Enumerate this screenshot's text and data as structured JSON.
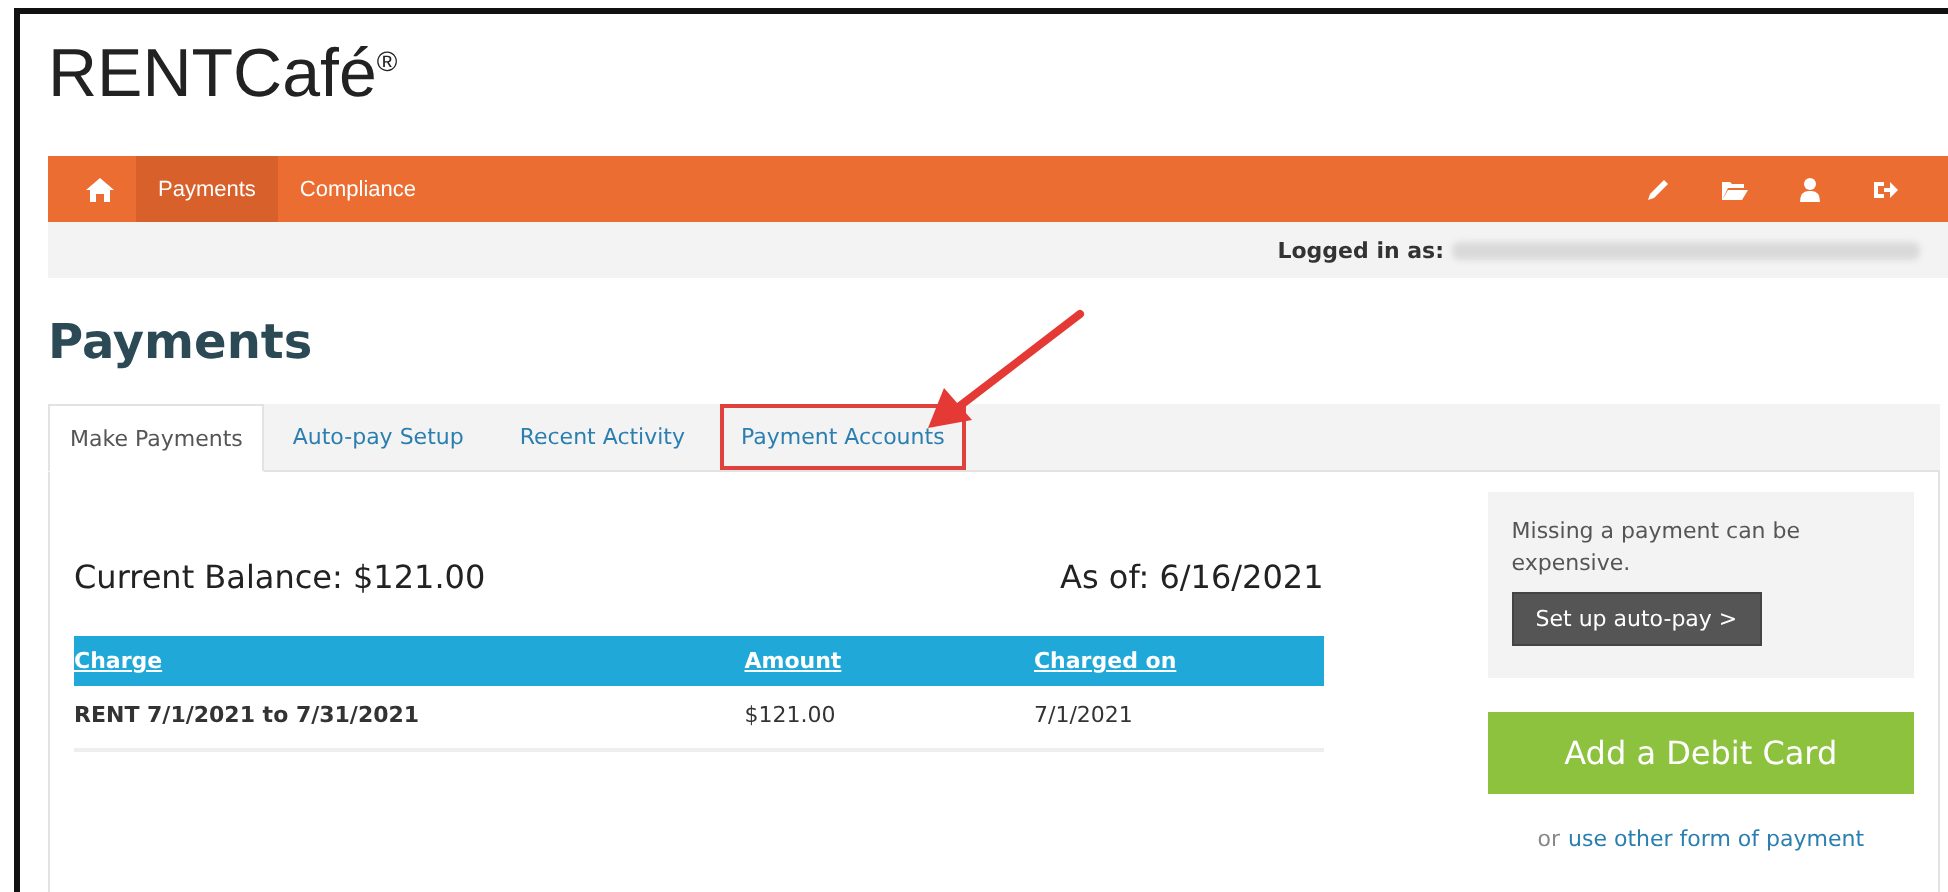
{
  "logo": {
    "text": "RENTCafé",
    "mark": "®"
  },
  "nav": {
    "items": [
      {
        "kind": "home",
        "selected": false
      },
      {
        "kind": "link",
        "label": "Payments",
        "selected": true
      },
      {
        "kind": "link",
        "label": "Compliance",
        "selected": false
      }
    ]
  },
  "user_bar": {
    "label": "Logged in as:"
  },
  "page_title": "Payments",
  "tabs": [
    {
      "label": "Make Payments",
      "selected": true,
      "highlighted": false
    },
    {
      "label": "Auto-pay Setup",
      "selected": false,
      "highlighted": false
    },
    {
      "label": "Recent Activity",
      "selected": false,
      "highlighted": false
    },
    {
      "label": "Payment Accounts",
      "selected": false,
      "highlighted": true
    }
  ],
  "balance": {
    "label": "Current Balance: $121.00",
    "as_of": "As of: 6/16/2021"
  },
  "table": {
    "columns": [
      "Charge",
      "Amount",
      "Charged on"
    ],
    "rows": [
      [
        "RENT 7/1/2021 to 7/31/2021",
        "$121.00",
        "7/1/2021"
      ]
    ]
  },
  "autopay_box": {
    "message": "Missing a payment can be expensive.",
    "button": "Set up auto-pay >"
  },
  "add_card_button": "Add a Debit Card",
  "other_payment": {
    "prefix": "or",
    "link": "use other form of payment"
  }
}
